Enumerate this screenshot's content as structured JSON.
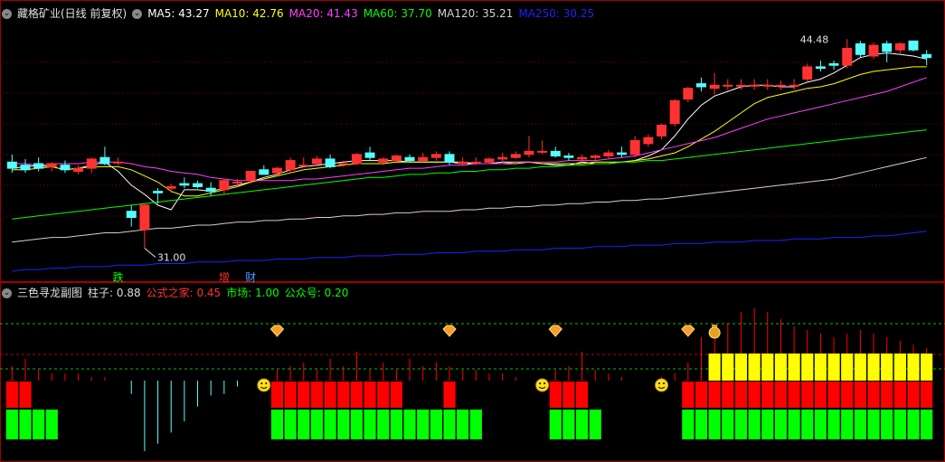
{
  "main_panel": {
    "stock_title": "藏格矿业(日线 前复权)",
    "ma_legend": [
      {
        "label": "MA5:",
        "value": "43.27",
        "color": "#ffffff"
      },
      {
        "label": "MA10:",
        "value": "42.76",
        "color": "#ffff00"
      },
      {
        "label": "MA20:",
        "value": "41.43",
        "color": "#ff40ff"
      },
      {
        "label": "MA60:",
        "value": "37.70",
        "color": "#00ff00"
      },
      {
        "label": "MA120:",
        "value": "35.21",
        "color": "#d0d0d0"
      },
      {
        "label": "MA250:",
        "value": "30.25",
        "color": "#2020ff"
      }
    ],
    "high_label": "44.48",
    "low_label": "31.00",
    "markers": [
      {
        "text": "跌",
        "color": "#00ff00",
        "bar": 8
      },
      {
        "text": "增",
        "color": "#ff3030",
        "bar": 16
      },
      {
        "text": "财",
        "color": "#40a0ff",
        "bar": 18
      }
    ]
  },
  "sub_panel": {
    "indicator_name": "三色寻龙副图",
    "legend": [
      {
        "label": "柱子:",
        "value": "0.88",
        "color": "#dddddd"
      },
      {
        "label": "公式之家:",
        "value": "0.45",
        "color": "#ff3030"
      },
      {
        "label": "市场:",
        "value": "1.00",
        "color": "#00ff00"
      },
      {
        "label": "公众号:",
        "value": "0.20",
        "color": "#00ff00"
      }
    ]
  },
  "colors": {
    "up": "#ff3232",
    "down": "#54ffff",
    "grid": "#7a0000",
    "border": "#a00000",
    "ma5": "#ffffff",
    "ma10": "#ffff00",
    "ma20": "#ff40ff",
    "ma60": "#00ff00",
    "ma120": "#d0d0d0",
    "ma250": "#2020ff",
    "sub_green": "#00ff00",
    "sub_red": "#ff0000",
    "sub_yellow": "#ffff00",
    "sub_cyan": "#54ffff",
    "dash_green": "#00c000",
    "dash_red": "#c00000"
  },
  "chart_data": {
    "type": "candlestick",
    "y_range": [
      29.5,
      45.5
    ],
    "candles": [
      {
        "o": 36.6,
        "h": 37.1,
        "l": 35.9,
        "c": 36.2
      },
      {
        "o": 36.4,
        "h": 36.8,
        "l": 35.9,
        "c": 36.1
      },
      {
        "o": 36.5,
        "h": 36.9,
        "l": 36.0,
        "c": 36.2
      },
      {
        "o": 36.3,
        "h": 36.6,
        "l": 36.0,
        "c": 36.5
      },
      {
        "o": 36.4,
        "h": 36.7,
        "l": 35.9,
        "c": 36.1
      },
      {
        "o": 36.0,
        "h": 36.4,
        "l": 35.8,
        "c": 36.2
      },
      {
        "o": 36.2,
        "h": 36.9,
        "l": 35.9,
        "c": 36.8
      },
      {
        "o": 36.9,
        "h": 37.6,
        "l": 36.4,
        "c": 36.5
      },
      {
        "o": 36.6,
        "h": 36.9,
        "l": 36.4,
        "c": 36.6
      },
      {
        "o": 33.4,
        "h": 33.8,
        "l": 32.4,
        "c": 33.0
      },
      {
        "o": 32.2,
        "h": 33.9,
        "l": 31.0,
        "c": 33.8
      },
      {
        "o": 34.7,
        "h": 34.9,
        "l": 33.9,
        "c": 34.6
      },
      {
        "o": 34.9,
        "h": 35.2,
        "l": 34.6,
        "c": 35.0
      },
      {
        "o": 35.2,
        "h": 35.6,
        "l": 34.9,
        "c": 35.1
      },
      {
        "o": 35.2,
        "h": 35.4,
        "l": 34.9,
        "c": 35.0
      },
      {
        "o": 34.9,
        "h": 35.3,
        "l": 34.4,
        "c": 34.7
      },
      {
        "o": 34.8,
        "h": 35.5,
        "l": 34.5,
        "c": 35.4
      },
      {
        "o": 35.3,
        "h": 35.5,
        "l": 35.0,
        "c": 35.3
      },
      {
        "o": 35.4,
        "h": 36.0,
        "l": 35.2,
        "c": 36.0
      },
      {
        "o": 36.1,
        "h": 36.4,
        "l": 35.8,
        "c": 35.8
      },
      {
        "o": 35.9,
        "h": 36.3,
        "l": 35.7,
        "c": 36.2
      },
      {
        "o": 36.1,
        "h": 36.9,
        "l": 35.9,
        "c": 36.7
      },
      {
        "o": 36.4,
        "h": 36.9,
        "l": 36.3,
        "c": 36.4
      },
      {
        "o": 36.5,
        "h": 37.0,
        "l": 36.3,
        "c": 36.8
      },
      {
        "o": 36.8,
        "h": 37.1,
        "l": 36.2,
        "c": 36.3
      },
      {
        "o": 36.5,
        "h": 36.7,
        "l": 36.3,
        "c": 36.5
      },
      {
        "o": 36.5,
        "h": 37.2,
        "l": 36.4,
        "c": 37.1
      },
      {
        "o": 37.2,
        "h": 37.6,
        "l": 36.7,
        "c": 36.9
      },
      {
        "o": 36.6,
        "h": 36.9,
        "l": 36.4,
        "c": 36.8
      },
      {
        "o": 36.7,
        "h": 37.1,
        "l": 36.5,
        "c": 37.0
      },
      {
        "o": 36.9,
        "h": 37.1,
        "l": 36.6,
        "c": 36.7
      },
      {
        "o": 36.7,
        "h": 37.2,
        "l": 36.6,
        "c": 36.9
      },
      {
        "o": 36.9,
        "h": 37.3,
        "l": 36.7,
        "c": 37.1
      },
      {
        "o": 37.1,
        "h": 37.3,
        "l": 36.4,
        "c": 36.6
      },
      {
        "o": 36.5,
        "h": 36.9,
        "l": 36.4,
        "c": 36.6
      },
      {
        "o": 36.6,
        "h": 36.9,
        "l": 36.4,
        "c": 36.6
      },
      {
        "o": 36.6,
        "h": 36.9,
        "l": 36.5,
        "c": 36.8
      },
      {
        "o": 36.8,
        "h": 37.2,
        "l": 36.6,
        "c": 36.9
      },
      {
        "o": 36.9,
        "h": 37.3,
        "l": 36.8,
        "c": 37.1
      },
      {
        "o": 37.1,
        "h": 38.3,
        "l": 36.9,
        "c": 37.3
      },
      {
        "o": 37.3,
        "h": 38.0,
        "l": 37.1,
        "c": 37.3
      },
      {
        "o": 37.3,
        "h": 37.6,
        "l": 36.9,
        "c": 37.0
      },
      {
        "o": 37.0,
        "h": 37.2,
        "l": 36.7,
        "c": 36.9
      },
      {
        "o": 36.8,
        "h": 37.1,
        "l": 36.6,
        "c": 36.9
      },
      {
        "o": 36.9,
        "h": 37.1,
        "l": 36.7,
        "c": 37.0
      },
      {
        "o": 37.0,
        "h": 37.4,
        "l": 36.8,
        "c": 37.2
      },
      {
        "o": 37.2,
        "h": 37.6,
        "l": 36.9,
        "c": 37.1
      },
      {
        "o": 37.1,
        "h": 38.3,
        "l": 36.9,
        "c": 38.0
      },
      {
        "o": 37.8,
        "h": 38.4,
        "l": 37.6,
        "c": 38.2
      },
      {
        "o": 38.3,
        "h": 39.1,
        "l": 38.1,
        "c": 39.0
      },
      {
        "o": 39.1,
        "h": 40.7,
        "l": 38.9,
        "c": 40.6
      },
      {
        "o": 40.7,
        "h": 41.5,
        "l": 40.5,
        "c": 41.4
      },
      {
        "o": 41.7,
        "h": 42.1,
        "l": 41.2,
        "c": 41.5
      },
      {
        "o": 41.4,
        "h": 42.4,
        "l": 41.0,
        "c": 41.6
      },
      {
        "o": 41.6,
        "h": 42.0,
        "l": 41.3,
        "c": 41.6
      },
      {
        "o": 41.6,
        "h": 42.0,
        "l": 41.3,
        "c": 41.6
      },
      {
        "o": 41.6,
        "h": 42.0,
        "l": 41.3,
        "c": 41.6
      },
      {
        "o": 41.6,
        "h": 42.0,
        "l": 41.3,
        "c": 41.6
      },
      {
        "o": 41.6,
        "h": 41.9,
        "l": 41.3,
        "c": 41.6
      },
      {
        "o": 41.6,
        "h": 42.0,
        "l": 41.3,
        "c": 41.6
      },
      {
        "o": 42.0,
        "h": 43.0,
        "l": 41.8,
        "c": 42.8
      },
      {
        "o": 42.8,
        "h": 43.2,
        "l": 42.5,
        "c": 42.7
      },
      {
        "o": 43.0,
        "h": 43.2,
        "l": 42.6,
        "c": 42.9
      },
      {
        "o": 42.9,
        "h": 44.6,
        "l": 42.7,
        "c": 44.0
      },
      {
        "o": 44.3,
        "h": 44.5,
        "l": 43.4,
        "c": 43.6
      },
      {
        "o": 43.5,
        "h": 44.4,
        "l": 43.3,
        "c": 44.2
      },
      {
        "o": 44.3,
        "h": 44.5,
        "l": 43.1,
        "c": 43.8
      },
      {
        "o": 43.9,
        "h": 44.4,
        "l": 43.6,
        "c": 44.3
      },
      {
        "o": 44.48,
        "h": 44.48,
        "l": 43.8,
        "c": 43.9
      },
      {
        "o": 43.6,
        "h": 43.9,
        "l": 42.9,
        "c": 43.4
      }
    ],
    "ma_series": [
      {
        "name": "MA5",
        "values": [
          36.2,
          36.3,
          36.4,
          36.3,
          36.1,
          36.2,
          36.4,
          36.6,
          36.0,
          35.1,
          34.5,
          33.8,
          33.5,
          34.8,
          34.8,
          34.7,
          34.9,
          35.1,
          35.3,
          35.6,
          35.8,
          36.1,
          36.3,
          36.4,
          36.5,
          36.6,
          36.7,
          36.7,
          36.7,
          36.7,
          36.6,
          36.6,
          36.6,
          36.6,
          36.5,
          36.5,
          36.5,
          36.6,
          36.6,
          36.6,
          36.5,
          36.4,
          36.4,
          36.6,
          36.5,
          36.5,
          36.6,
          36.7,
          37.0,
          37.4,
          38.3,
          39.4,
          40.3,
          40.9,
          41.2,
          41.5,
          41.6,
          41.6,
          41.5,
          41.5,
          41.8,
          42.0,
          42.4,
          42.9,
          43.4,
          43.6,
          43.7,
          43.6,
          43.5,
          43.3
        ]
      },
      {
        "name": "MA10",
        "values": [
          36.1,
          36.1,
          36.2,
          36.3,
          36.1,
          36.2,
          36.3,
          36.3,
          36.3,
          36.1,
          35.7,
          35.3,
          34.7,
          34.4,
          34.4,
          34.6,
          34.8,
          35.0,
          35.3,
          35.5,
          35.7,
          35.9,
          36.1,
          36.2,
          36.3,
          36.4,
          36.5,
          36.5,
          36.5,
          36.6,
          36.6,
          36.6,
          36.6,
          36.6,
          36.6,
          36.5,
          36.5,
          36.5,
          36.5,
          36.6,
          36.5,
          36.5,
          36.5,
          36.5,
          36.6,
          36.6,
          36.6,
          36.7,
          36.8,
          37.0,
          37.2,
          37.6,
          38.1,
          38.6,
          39.2,
          39.8,
          40.4,
          40.8,
          41.0,
          41.2,
          41.4,
          41.5,
          41.7,
          42.0,
          42.3,
          42.5,
          42.6,
          42.7,
          42.8,
          42.8
        ]
      },
      {
        "name": "MA20",
        "values": [
          36.5,
          36.5,
          36.4,
          36.5,
          36.5,
          36.5,
          36.6,
          36.6,
          36.6,
          36.5,
          36.3,
          36.2,
          36.0,
          35.9,
          35.8,
          35.6,
          35.5,
          35.4,
          35.4,
          35.4,
          35.4,
          35.4,
          35.5,
          35.5,
          35.6,
          35.7,
          35.8,
          35.9,
          36.0,
          36.1,
          36.2,
          36.2,
          36.3,
          36.4,
          36.4,
          36.5,
          36.5,
          36.5,
          36.6,
          36.6,
          36.6,
          36.6,
          36.7,
          36.7,
          36.7,
          36.8,
          36.9,
          37.0,
          37.2,
          37.4,
          37.6,
          37.8,
          38.0,
          38.2,
          38.5,
          38.8,
          39.1,
          39.4,
          39.6,
          39.8,
          40.0,
          40.2,
          40.4,
          40.6,
          40.8,
          41.0,
          41.2,
          41.5,
          41.8,
          42.1
        ]
      },
      {
        "name": "MA60",
        "values": [
          32.9,
          33.0,
          33.1,
          33.2,
          33.3,
          33.4,
          33.5,
          33.6,
          33.7,
          33.8,
          33.9,
          34.0,
          34.1,
          34.2,
          34.3,
          34.4,
          34.5,
          34.6,
          34.7,
          34.8,
          34.9,
          35.0,
          35.1,
          35.2,
          35.3,
          35.4,
          35.5,
          35.6,
          35.6,
          35.7,
          35.8,
          35.8,
          35.9,
          35.9,
          36.0,
          36.0,
          36.1,
          36.1,
          36.2,
          36.2,
          36.3,
          36.3,
          36.4,
          36.4,
          36.5,
          36.5,
          36.6,
          36.6,
          36.7,
          36.7,
          36.8,
          36.9,
          37.0,
          37.1,
          37.2,
          37.3,
          37.4,
          37.5,
          37.6,
          37.7,
          37.8,
          37.9,
          38.0,
          38.1,
          38.2,
          38.3,
          38.4,
          38.5,
          38.6,
          38.7
        ]
      },
      {
        "name": "MA120",
        "values": [
          31.4,
          31.5,
          31.6,
          31.7,
          31.7,
          31.8,
          31.9,
          32.0,
          32.0,
          32.1,
          32.2,
          32.3,
          32.3,
          32.4,
          32.5,
          32.5,
          32.6,
          32.7,
          32.7,
          32.8,
          32.8,
          32.9,
          32.9,
          33.0,
          33.0,
          33.1,
          33.1,
          33.2,
          33.2,
          33.3,
          33.3,
          33.4,
          33.4,
          33.4,
          33.5,
          33.5,
          33.6,
          33.6,
          33.7,
          33.7,
          33.8,
          33.8,
          33.9,
          33.9,
          34.0,
          34.0,
          34.1,
          34.1,
          34.2,
          34.2,
          34.3,
          34.4,
          34.5,
          34.6,
          34.7,
          34.8,
          34.9,
          35.0,
          35.1,
          35.2,
          35.3,
          35.4,
          35.5,
          35.7,
          35.9,
          36.1,
          36.3,
          36.5,
          36.7,
          36.9
        ]
      },
      {
        "name": "MA250",
        "values": [
          29.5,
          29.6,
          29.6,
          29.7,
          29.7,
          29.8,
          29.8,
          29.8,
          29.9,
          29.9,
          29.9,
          30.0,
          30.0,
          30.0,
          30.1,
          30.1,
          30.1,
          30.2,
          30.2,
          30.2,
          30.3,
          30.3,
          30.3,
          30.4,
          30.4,
          30.4,
          30.5,
          30.5,
          30.5,
          30.6,
          30.6,
          30.6,
          30.7,
          30.7,
          30.7,
          30.8,
          30.8,
          30.8,
          30.9,
          30.9,
          30.9,
          31.0,
          31.0,
          31.0,
          31.1,
          31.1,
          31.1,
          31.2,
          31.2,
          31.2,
          31.3,
          31.3,
          31.3,
          31.4,
          31.4,
          31.4,
          31.5,
          31.5,
          31.5,
          31.6,
          31.6,
          31.6,
          31.7,
          31.7,
          31.7,
          31.8,
          31.8,
          31.9,
          32.0,
          32.1
        ]
      }
    ],
    "sub_indicator": {
      "green_blocks": [
        0,
        1,
        2,
        3,
        20,
        21,
        22,
        23,
        24,
        25,
        26,
        27,
        28,
        29,
        30,
        31,
        32,
        33,
        34,
        35,
        41,
        42,
        43,
        44,
        51,
        52,
        53,
        54,
        55,
        56,
        57,
        58,
        59,
        60,
        61,
        62,
        63,
        64,
        65,
        66,
        67,
        68,
        69
      ],
      "red_blocks": [
        0,
        1,
        20,
        21,
        22,
        23,
        24,
        25,
        26,
        27,
        28,
        29,
        33,
        41,
        42,
        43,
        51,
        52,
        53,
        54,
        55,
        56,
        57,
        58,
        59,
        60,
        61,
        62,
        63,
        64,
        65,
        66,
        67,
        68,
        69
      ],
      "yellow_blocks": [
        53,
        54,
        55,
        56,
        57,
        58,
        59,
        60,
        61,
        62,
        63,
        64,
        65,
        66,
        67,
        68,
        69
      ],
      "cyan_spikes": [
        {
          "bar": 9,
          "depth": 0.18
        },
        {
          "bar": 10,
          "depth": 0.95
        },
        {
          "bar": 11,
          "depth": 0.85
        },
        {
          "bar": 12,
          "depth": 0.7
        },
        {
          "bar": 13,
          "depth": 0.55
        },
        {
          "bar": 14,
          "depth": 0.35
        },
        {
          "bar": 15,
          "depth": 0.2
        },
        {
          "bar": 16,
          "depth": 0.18
        },
        {
          "bar": 17,
          "depth": 0.08
        }
      ],
      "red_spikes": [
        0.4,
        0.6,
        0.3,
        0.2,
        0.2,
        0.2,
        0.1,
        0.1,
        0,
        0,
        0,
        0,
        0,
        0,
        0,
        0,
        0,
        0,
        0,
        0,
        0.3,
        0.4,
        0.5,
        0.3,
        0.6,
        0.4,
        0.8,
        0.3,
        0.5,
        0.3,
        0.6,
        0.4,
        0.5,
        0.4,
        0.3,
        0.3,
        0.2,
        0.2,
        0.1,
        0,
        0,
        0.3,
        0.4,
        0.8,
        0.3,
        0.2,
        0.1,
        0,
        0,
        0.1,
        0.2,
        0.5,
        1.2,
        1.4,
        1.6,
        1.9,
        2.0,
        1.9,
        1.7,
        1.5,
        1.4,
        1.3,
        1.2,
        1.3,
        1.4,
        1.3,
        1.2,
        1.1,
        1.0,
        0.9
      ],
      "gem_markers": [
        20,
        33,
        41,
        51
      ],
      "money_marker": 53,
      "smile_markers": [
        19,
        40,
        49
      ]
    }
  }
}
